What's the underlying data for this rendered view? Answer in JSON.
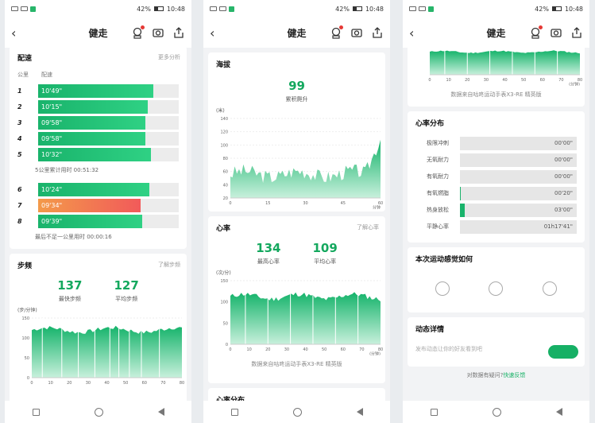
{
  "status": {
    "battery": "42%",
    "time": "10:48"
  },
  "app": {
    "title": "健走",
    "back": "‹"
  },
  "pace": {
    "title": "配速",
    "more": "更多分析",
    "col_km": "公里",
    "col_pace": "配速",
    "rows": [
      {
        "km": "1",
        "pace": "10'49\"",
        "fill": 0.82,
        "slow": false
      },
      {
        "km": "2",
        "pace": "10'15\"",
        "fill": 0.78,
        "slow": false
      },
      {
        "km": "3",
        "pace": "09'58\"",
        "fill": 0.76,
        "slow": false
      },
      {
        "km": "4",
        "pace": "09'58\"",
        "fill": 0.76,
        "slow": false
      },
      {
        "km": "5",
        "pace": "10'32\"",
        "fill": 0.8,
        "slow": false
      }
    ],
    "note1": "5公里累计用时 00:51:32",
    "rows2": [
      {
        "km": "6",
        "pace": "10'24\"",
        "fill": 0.79,
        "slow": false
      },
      {
        "km": "7",
        "pace": "09'34\"",
        "fill": 0.73,
        "slow": true
      },
      {
        "km": "8",
        "pace": "09'39\"",
        "fill": 0.74,
        "slow": false
      }
    ],
    "note2": "最后不足一公里用时 00:00:16"
  },
  "cadence": {
    "title": "步频",
    "link": "了解步频",
    "max": "137",
    "max_label": "最快步频",
    "avg": "127",
    "avg_label": "平均步频",
    "unit": "(步/分钟)",
    "yticks": [
      "150",
      "100",
      "50",
      "0"
    ],
    "xticks": [
      "0",
      "10",
      "20",
      "30",
      "40",
      "50",
      "60",
      "70",
      "80"
    ]
  },
  "altitude": {
    "title": "海拔",
    "value": "99",
    "label": "累积爬升",
    "unit": "(米)",
    "yticks": [
      "140",
      "120",
      "100",
      "80",
      "60",
      "40",
      "20"
    ],
    "xticks": [
      "0",
      "15",
      "30",
      "45",
      "60"
    ],
    "xunit": "分钟"
  },
  "hr": {
    "title": "心率",
    "link": "了解心率",
    "max": "134",
    "max_label": "最高心率",
    "avg": "109",
    "avg_label": "平均心率",
    "unit": "(次/分)",
    "yticks": [
      "150",
      "100",
      "50",
      "0"
    ],
    "xticks": [
      "0",
      "10",
      "20",
      "30",
      "40",
      "50",
      "60",
      "70",
      "80"
    ],
    "xunit": "(分钟)",
    "source": "数据来自咕咚运动手表X3-RE 精英版"
  },
  "hr_dist": {
    "title": "心率分布",
    "zones": [
      {
        "label": "极限冲刺",
        "time": "00'00\"",
        "fill": 0
      },
      {
        "label": "无氧耐力",
        "time": "00'00\"",
        "fill": 0
      },
      {
        "label": "有氧耐力",
        "time": "00'00\"",
        "fill": 0
      },
      {
        "label": "有氧燃脂",
        "time": "00'20\"",
        "fill": 0.006
      },
      {
        "label": "热身放松",
        "time": "03'00\"",
        "fill": 0.04
      },
      {
        "label": "平静心率",
        "time": "01h17'41\"",
        "fill": 0
      }
    ]
  },
  "feel": {
    "title": "本次运动感觉如何"
  },
  "share": {
    "title": "动态详情",
    "placeholder": "发布动态让你的好友看到吧"
  },
  "feedback": {
    "text": "对数据有疑问?",
    "link": "快速反馈"
  },
  "section_partial": {
    "hr_dist": "心率分布"
  },
  "p3_top": {
    "xticks": [
      "0",
      "10",
      "20",
      "30",
      "40",
      "50",
      "60",
      "70",
      "80"
    ],
    "xunit": "(分钟)",
    "source": "数据来自咕咚运动手表X3-RE 精英版"
  },
  "colors": {
    "accent": "#19b36b",
    "slow": "#f25a5a"
  }
}
